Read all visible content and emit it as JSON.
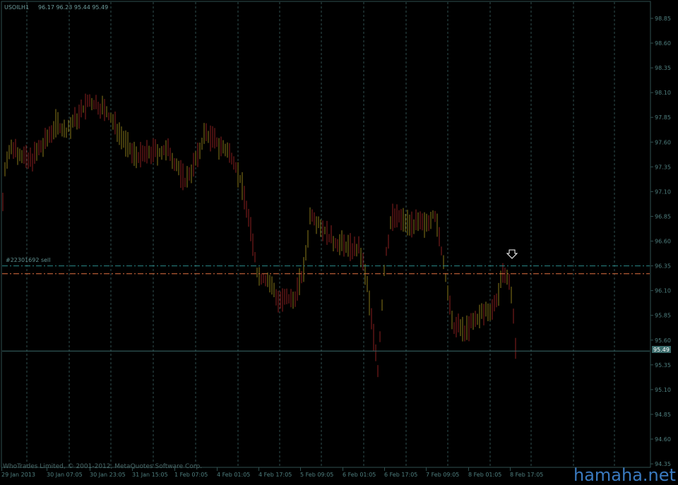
{
  "header": {
    "symbol": "USOILH1",
    "ohlc": "96.17 96.23 95.44 95.49"
  },
  "order_label": "#22301692 sell",
  "copyright": "WhoTrades Limited, © 2001-2012, MetaQuotes Software Corp.",
  "watermark": "hamaha.net",
  "colors": {
    "background": "#000000",
    "frame": "#2f4f4f",
    "grid": "#2f4f4f",
    "axis_text": "#4f7f7f",
    "bull": "#8a7a1a",
    "bear": "#8b2020",
    "order_line": "#2a8a8a",
    "sl_line": "#e07040",
    "bid_line": "#3a6a6a",
    "watermark": "#3a7ac0"
  },
  "chart_data": {
    "type": "bar",
    "price_axis": {
      "min": 94.4,
      "max": 96.45,
      "ticks": [
        "96.85",
        "96.60",
        "96.35",
        "96.10",
        "97.85",
        "97.60",
        "97.35",
        "97.10",
        "96.85",
        "96.60",
        "96.35",
        "96.10",
        "95.85",
        "95.60",
        "95.35",
        "95.10",
        "94.85",
        "94.60",
        "94.35"
      ],
      "tick_values": [
        98.85,
        98.6,
        98.35,
        98.1,
        97.85,
        97.6,
        97.35,
        97.1,
        96.85,
        96.6,
        96.35,
        96.1,
        95.85,
        95.6,
        95.35,
        95.1,
        94.85,
        94.6,
        94.35
      ],
      "tick_labels": [
        "98.85",
        "98.60",
        "98.35",
        "98.10",
        "97.85",
        "97.60",
        "97.35",
        "97.10",
        "96.85",
        "96.60",
        "96.35",
        "96.10",
        "95.85",
        "95.60",
        "95.35",
        "95.10",
        "94.85",
        "94.60",
        "94.35"
      ]
    },
    "y_range": [
      94.32,
      98.98
    ],
    "time_axis": {
      "labels": [
        "29 Jan 2013",
        "30 Jan 07:05",
        "30 Jan 23:05",
        "31 Jan 15:05",
        "1 Feb 07:05",
        "4 Feb 01:05",
        "4 Feb 17:05",
        "5 Feb 09:05",
        "6 Feb 01:05",
        "6 Feb 17:05",
        "7 Feb 09:05",
        "8 Feb 01:05",
        "8 Feb 17:05"
      ]
    },
    "current_price": "95.49",
    "order_price": 96.35,
    "stop_price": 96.27,
    "grid": true
  }
}
